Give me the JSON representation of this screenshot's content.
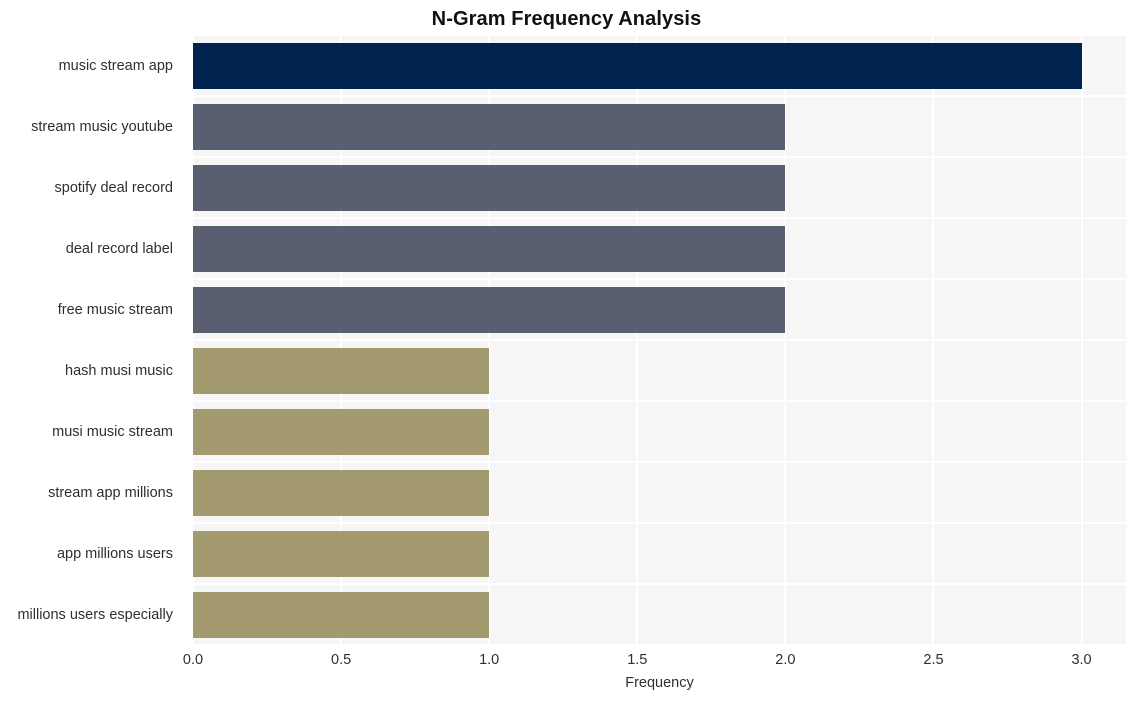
{
  "chart_data": {
    "type": "bar",
    "orientation": "horizontal",
    "title": "N-Gram Frequency Analysis",
    "xlabel": "Frequency",
    "ylabel": "",
    "xlim": [
      0,
      3.15
    ],
    "xticks": [
      "0.0",
      "0.5",
      "1.0",
      "1.5",
      "2.0",
      "2.5",
      "3.0"
    ],
    "xtick_values": [
      0,
      0.5,
      1,
      1.5,
      2,
      2.5,
      3
    ],
    "grid": true,
    "legend": "none",
    "categories": [
      "music stream app",
      "stream music youtube",
      "spotify deal record",
      "deal record label",
      "free music stream",
      "hash musi music",
      "musi music stream",
      "stream app millions",
      "app millions users",
      "millions users especially"
    ],
    "values": [
      3,
      2,
      2,
      2,
      2,
      1,
      1,
      1,
      1,
      1
    ],
    "bar_colors": [
      "#002350",
      "#595e70",
      "#595e70",
      "#595e70",
      "#595e70",
      "#a39b6f",
      "#a39b6f",
      "#a39b6f",
      "#a39b6f",
      "#a39b6f"
    ],
    "plot_background": "#f6f6f7",
    "gridline_color": "#ffffff",
    "figure_background": "#ffffff",
    "text_color": "#2f2f2f",
    "title_color": "#111111"
  }
}
